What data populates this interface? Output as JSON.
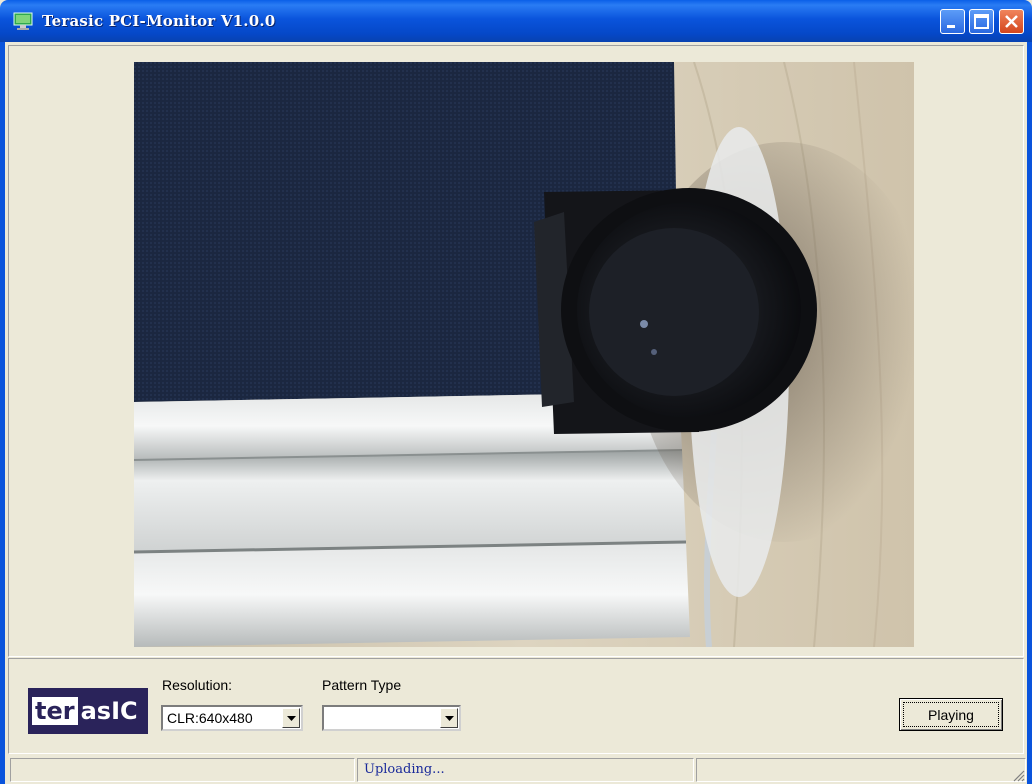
{
  "window": {
    "title": "Terasic PCI-Monitor V1.0.0"
  },
  "logo": {
    "part1": "ter",
    "part2": "asIC"
  },
  "controls": {
    "resolution_label": "Resolution:",
    "resolution_value": "CLR:640x480",
    "pattern_label": "Pattern Type",
    "pattern_value": "",
    "play_button_label": "Playing"
  },
  "statusbar": {
    "pane1": "",
    "pane2": "Uploading...",
    "pane3": ""
  },
  "colors": {
    "titlebar_blue": "#0A54DC",
    "window_bg": "#ECE9D8",
    "logo_bg": "#2A235A",
    "status_text": "#1a2a9a"
  }
}
